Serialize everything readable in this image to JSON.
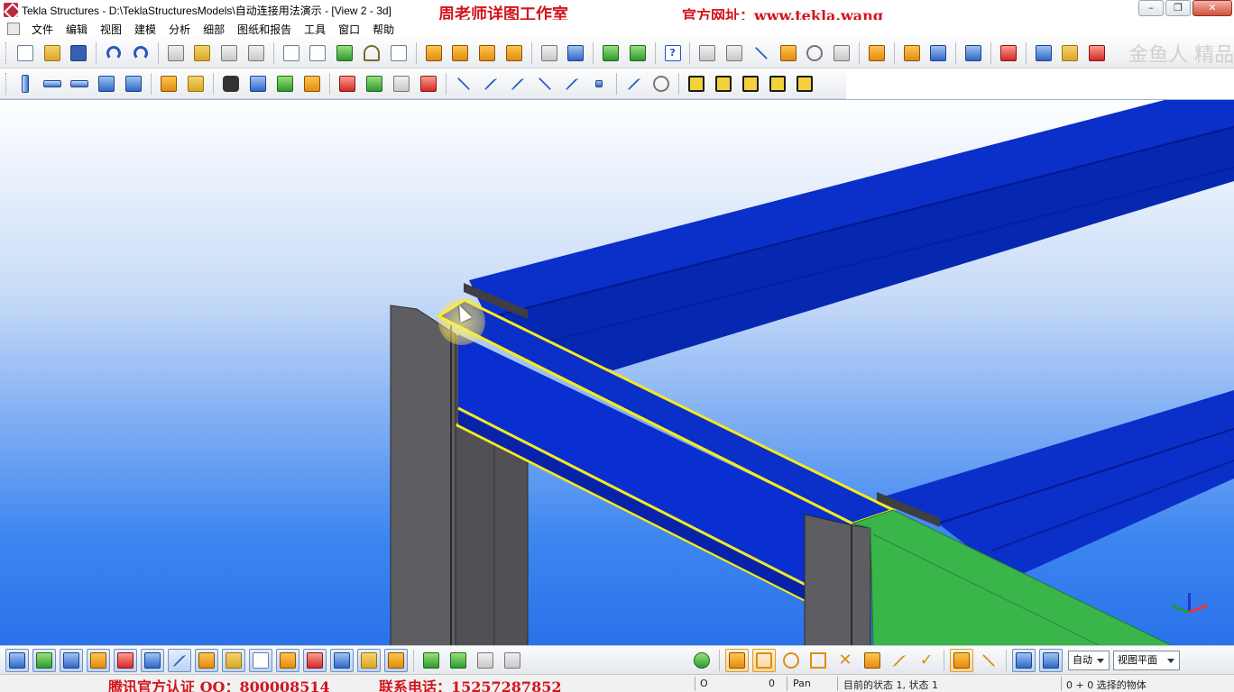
{
  "window": {
    "title": "Tekla Structures - D:\\TeklaStructuresModels\\自动连接用法演示 - [View 2 - 3d]",
    "controls": {
      "minimize": "–",
      "restore": "❐",
      "close": "✕"
    }
  },
  "watermarks": {
    "studio": "周老师详图工作室",
    "website": "官方网址：www.tekla.wang",
    "qq": "腾讯官方认证 QQ：800008514",
    "phone": "联系电话：15257287852",
    "logo_text": "金鱼人 精品"
  },
  "menu": {
    "items": [
      "文件",
      "编辑",
      "视图",
      "建模",
      "分析",
      "细部",
      "图纸和报告",
      "工具",
      "窗口",
      "帮助"
    ]
  },
  "toolbar_top": {
    "icons": [
      "new-icon",
      "open-icon",
      "save-icon",
      "undo-icon",
      "redo-icon",
      "copy-icon",
      "paste-icon",
      "print-icon",
      "clash-icon",
      "view-icon",
      "view2-icon",
      "layers-icon",
      "scissors-icon",
      "select-area-icon",
      "orange-box-icon",
      "orange-copy-icon",
      "orange-move-icon",
      "orange-frame-icon",
      "arrow-icon",
      "arrow2-icon",
      "green-box-icon",
      "green-box2-icon",
      "help-query-icon",
      "dimension-icon",
      "dimension2-icon",
      "angle-icon",
      "angle2-icon",
      "arc-icon",
      "frame-icon",
      "pin-icon",
      "stack-icon",
      "assembly-icon",
      "grid-icon",
      "flag-icon",
      "forward-icon",
      "drawing-icon",
      "tools-icon"
    ],
    "help_label": "?"
  },
  "toolbar_second": {
    "icons": [
      "column-icon",
      "beam-icon",
      "polybeam-icon",
      "curved-beam-icon",
      "plate-icon",
      "bolt-icon",
      "weld-icon",
      "binoculars-icon",
      "t-beam-icon",
      "component-icon",
      "orange-cube-icon",
      "rebar-icon",
      "cut-icon",
      "fit-icon",
      "copy-dim-icon",
      "line-icon",
      "dashed-line-icon",
      "parallel-icon",
      "cross-icon",
      "cross2-icon",
      "point-icon",
      "slash-icon",
      "circle-icon",
      "ibeam-icon",
      "ibeam2-icon",
      "ibeam3-icon",
      "ibeam4-icon",
      "ibeam5-icon"
    ]
  },
  "bottom_toolbar": {
    "icons": [
      "select-pointer-icon",
      "select-part-icon",
      "select-object-icon",
      "select-box-icon",
      "select-grid-icon",
      "select-assembly-icon",
      "select-weld-icon",
      "select-component-icon",
      "select-bolt-icon",
      "select-view-icon",
      "select-cut-icon",
      "select-fit-icon",
      "select-curve-icon",
      "select-plane-icon",
      "select-tools-icon",
      "select-rebar-icon",
      "select-rebar2-icon",
      "select-grid2-icon",
      "select-grid3-icon"
    ],
    "snap_icons": [
      "snap-globe-icon",
      "snap-ref-icon",
      "snap-end-icon",
      "snap-center-icon",
      "snap-triangle-icon",
      "snap-x-icon",
      "snap-perp-icon",
      "snap-line-ext-icon",
      "snap-check-icon",
      "snap-hourglass-icon",
      "snap-arrow-icon",
      "snap-plane-icon",
      "snap-3d-icon"
    ],
    "snap_depth": "自动",
    "plane": "视图平面"
  },
  "status": {
    "mode": "O",
    "count": "0",
    "pan": "Pan",
    "state": "目前的状态 1, 状态 1",
    "selection": "0 + 0 选择的物体"
  },
  "colors": {
    "beam_blue": "#0a2fd0",
    "column_gray": "#5e5e62",
    "highlight_yellow": "#f6ea1c",
    "green_part": "#39b54a",
    "watermark_red": "#d4141c"
  }
}
